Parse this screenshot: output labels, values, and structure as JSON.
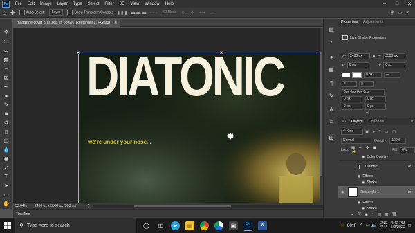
{
  "menubar": {
    "logo": "Ps",
    "items": [
      "File",
      "Edit",
      "Image",
      "Layer",
      "Type",
      "Select",
      "Filter",
      "3D",
      "View",
      "Window",
      "Help"
    ]
  },
  "options": {
    "auto_select": "Auto-Select:",
    "layer": "Layer",
    "show_transform": "Show Transform Controls",
    "mode_3d": "3D Mode:"
  },
  "document": {
    "tab_title": "magazine cover draft.psd @ 53.6% (Rectangle 1, RGB/8)",
    "title_text": "DIATONIC",
    "subtitle_text": "we're under your nose...",
    "zoom": "53.64%",
    "doc_size": "2480 px x 3508 px (300 ppi)"
  },
  "timeline": {
    "label": "Timeline"
  },
  "properties": {
    "tabs": [
      "Properties",
      "Adjustments"
    ],
    "header": "Live Shape Properties",
    "w_label": "W:",
    "w_value": "2480 px",
    "h_label": "H:",
    "h_value": "3508 px",
    "x_label": "X:",
    "x_value": "0 px",
    "y_label": "Y:",
    "y_value": "0 px",
    "stroke_value": "0 px",
    "radius": "0px 0px 0px 0px",
    "corner_values": [
      "0 px",
      "0 px",
      "0 px",
      "0 px"
    ]
  },
  "layers": {
    "tabs": [
      "3D",
      "Layers",
      "Channels"
    ],
    "kind": "Kind",
    "blend": "Normal",
    "opacity_label": "Opacity:",
    "opacity": "100%",
    "lock_label": "Lock:",
    "fill_label": "Fill:",
    "fill": "0%",
    "items": [
      {
        "name": "Color Overlay"
      },
      {
        "name": "Diatonic"
      },
      {
        "name": "Effects"
      },
      {
        "name": "Stroke"
      },
      {
        "name": "Rectangle 1"
      },
      {
        "name": "Effects"
      },
      {
        "name": "Stroke"
      }
    ]
  },
  "taskbar": {
    "search_placeholder": "Type here to search",
    "weather": "80°F",
    "lang": "ENG",
    "region": "INTL",
    "time": "4:42 PM",
    "date": "5/9/2022"
  },
  "colors": {
    "title": "#f6f1dc",
    "subtitle": "#d6c52e",
    "accent": "#31a8ff"
  }
}
